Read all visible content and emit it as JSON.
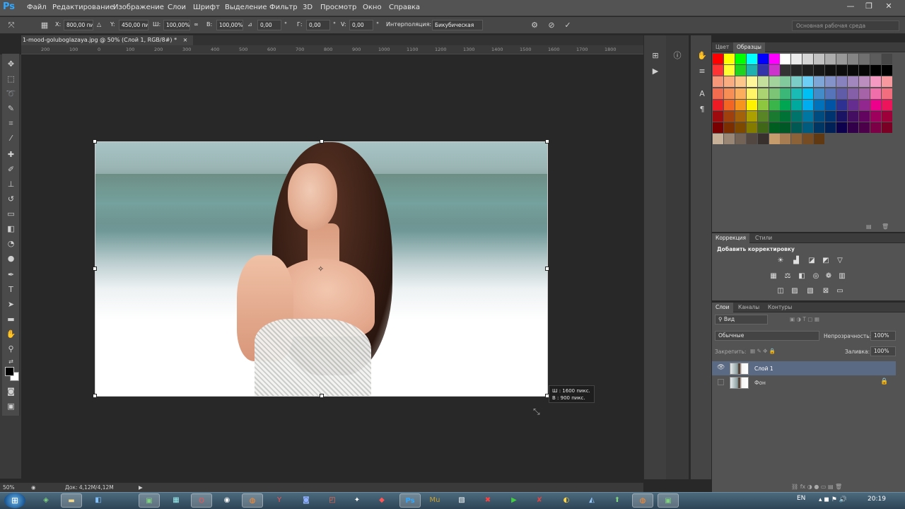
{
  "app": {
    "logo": "Ps",
    "menu": [
      "Файл",
      "Редактирование",
      "Изображение",
      "Слои",
      "Шрифт",
      "Выделение",
      "Фильтр",
      "3D",
      "Просмотр",
      "Окно",
      "Справка"
    ]
  },
  "options": {
    "x_label": "X:",
    "x_value": "800,00 пи",
    "y_label": "Y:",
    "y_value": "450,00 пи",
    "w_label": "Ш:",
    "w_value": "100,00%",
    "h_label": "В:",
    "h_value": "100,00%",
    "angle_value": "0,00",
    "deg1": "°",
    "hskew_label": "Г:",
    "hskew_value": "0,00",
    "deg2": "°",
    "vskew_label": "V:",
    "vskew_value": "0,00",
    "deg3": "°",
    "interp_label": "Интерполяция:",
    "interp_value": "Бикубическая",
    "workspace": "Основная рабочая среда"
  },
  "document": {
    "tab_title": "1-mood-goluboglazaya.jpg @ 50% (Слой 1, RGB/8#) *",
    "close": "×",
    "ruler_ticks": [
      "200",
      "100",
      "0",
      "100",
      "200",
      "300",
      "400",
      "500",
      "600",
      "700",
      "800",
      "900",
      "1000",
      "1100",
      "1200",
      "1300",
      "1400",
      "1500",
      "1600",
      "1700",
      "1800"
    ],
    "size_tip_w": "Ш :  1600 пикс.",
    "size_tip_h": "В :   900 пикс."
  },
  "swatches_panel": {
    "tabs": [
      "Цвет",
      "Образцы"
    ],
    "active_tab": "Образцы",
    "rows": [
      [
        "#ff0000",
        "#ffff00",
        "#00ff00",
        "#00ffff",
        "#0000ff",
        "#ff00ff",
        "#ffffff",
        "#ebebeb",
        "#d6d6d6",
        "#c2c2c2",
        "#adadad",
        "#999999",
        "#858585",
        "#707070",
        "#5c5c5c",
        "#474747"
      ],
      [
        "#ff3333",
        "#ffff33",
        "#1fd31f",
        "#1fb0b0",
        "#3333aa",
        "#cc33cc",
        "#333333",
        "#262626",
        "#1f1f1f",
        "#181818",
        "#111111",
        "#0d0d0d",
        "#0a0a0a",
        "#060606",
        "#000000",
        "#000000"
      ],
      [
        "#f7977a",
        "#f9ad81",
        "#fdc68a",
        "#fff79a",
        "#c4df9b",
        "#a2d39c",
        "#82ca9d",
        "#7bcdc8",
        "#6ecff6",
        "#7ea7d8",
        "#8493ca",
        "#8882be",
        "#a187be",
        "#bc8dbf",
        "#f49ac2",
        "#f6989d"
      ],
      [
        "#f26c4f",
        "#f68e56",
        "#fbaf5d",
        "#fff467",
        "#acd372",
        "#7cc576",
        "#3bb878",
        "#1abbb4",
        "#00bff3",
        "#438cca",
        "#5574b9",
        "#605ca8",
        "#855fa8",
        "#a763a8",
        "#f06ea9",
        "#f26d7d"
      ],
      [
        "#ed1c24",
        "#f26522",
        "#f7941d",
        "#fff200",
        "#8dc73f",
        "#39b54a",
        "#00a651",
        "#00a99d",
        "#00aeef",
        "#0072bc",
        "#0054a6",
        "#2e3192",
        "#662d91",
        "#92278f",
        "#ec008c",
        "#ed145b"
      ],
      [
        "#9e0b0f",
        "#a0410d",
        "#a36209",
        "#aba000",
        "#598527",
        "#1a7b30",
        "#007236",
        "#00746b",
        "#0076a3",
        "#004b80",
        "#003471",
        "#1b1464",
        "#440e62",
        "#630460",
        "#9e005d",
        "#9e0039"
      ],
      [
        "#790000",
        "#7b2e00",
        "#7d4900",
        "#827b00",
        "#406618",
        "#005e20",
        "#005826",
        "#005952",
        "#005b7f",
        "#003663",
        "#002157",
        "#0d004c",
        "#32004b",
        "#4b0049",
        "#7b0046",
        "#7a0026"
      ],
      [
        "#c7b299",
        "#998675",
        "#736357",
        "#534741",
        "#37302d",
        "#c69c6d",
        "#a67c52",
        "#8c6239",
        "#754c24",
        "#603913"
      ]
    ]
  },
  "corrections_panel": {
    "tabs": [
      "Коррекция",
      "Стили"
    ],
    "active_tab": "Коррекция",
    "heading": "Добавить корректировку"
  },
  "layers_panel": {
    "tabs": [
      "Слои",
      "Каналы",
      "Контуры"
    ],
    "active_tab": "Слои",
    "filter": "Вид",
    "blend_mode": "Обычные",
    "opacity_label": "Непрозрачность:",
    "opacity_value": "100%",
    "lock_label": "Закрепить:",
    "fill_label": "Заливка:",
    "fill_value": "100%",
    "layers": [
      {
        "name": "Слой 1",
        "selected": true,
        "visible": true
      },
      {
        "name": "Фон",
        "selected": false,
        "visible": false,
        "locked": true
      }
    ]
  },
  "status": {
    "zoom": "50%",
    "doc": "Док: 4,12M/4,12M"
  },
  "taskbar": {
    "lang": "EN",
    "time": "20:19"
  }
}
